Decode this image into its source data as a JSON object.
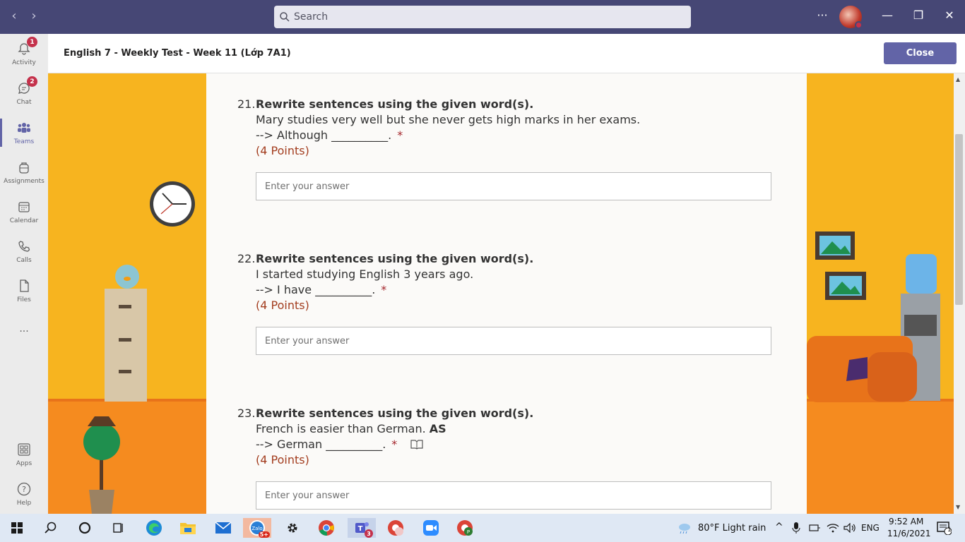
{
  "titlebar": {
    "search_placeholder": "Search",
    "more_label": "···",
    "minimize_label": "—",
    "maximize_label": "❐",
    "close_label": "✕"
  },
  "rail": {
    "items": [
      {
        "label": "Activity",
        "badge": "1"
      },
      {
        "label": "Chat",
        "badge": "2"
      },
      {
        "label": "Teams"
      },
      {
        "label": "Assignments"
      },
      {
        "label": "Calendar"
      },
      {
        "label": "Calls"
      },
      {
        "label": "Files"
      },
      {
        "label": "..."
      },
      {
        "label": "Apps"
      },
      {
        "label": "Help"
      }
    ]
  },
  "header": {
    "title": "English 7 - Weekly Test - Week 11 (Lớp 7A1)",
    "close_label": "Close"
  },
  "questions": [
    {
      "number": "21.",
      "title": "Rewrite sentences using the given word(s).",
      "sentence": "Mary studies very well but she never gets high marks in her exams.",
      "prompt": "--> Although __________.",
      "required": "*",
      "points": "(4 Points)",
      "placeholder": "Enter your answer"
    },
    {
      "number": "22.",
      "title": "Rewrite sentences using the given word(s).",
      "sentence": "I started studying English 3 years ago.",
      "prompt": "--> I have __________.",
      "required": "*",
      "points": "(4 Points)",
      "placeholder": "Enter your answer"
    },
    {
      "number": "23.",
      "title": "Rewrite sentences using the given word(s).",
      "sentence": "French is easier than German.",
      "sentence_bold": "AS",
      "prompt": "--> German __________.",
      "required": "*",
      "points": "(4 Points)",
      "placeholder": "Enter your answer"
    }
  ],
  "taskbar": {
    "weather": "80°F  Light rain",
    "language": "ENG",
    "time": "9:52 AM",
    "date": "11/6/2021",
    "zalo_badge": "5+",
    "teams_badge": "3",
    "notification_count": "1"
  },
  "colors": {
    "titlebar": "#464775",
    "accent": "#6264a7",
    "wall": "#f7b41f",
    "floor": "#f58b1f",
    "points": "#a33d1f"
  }
}
